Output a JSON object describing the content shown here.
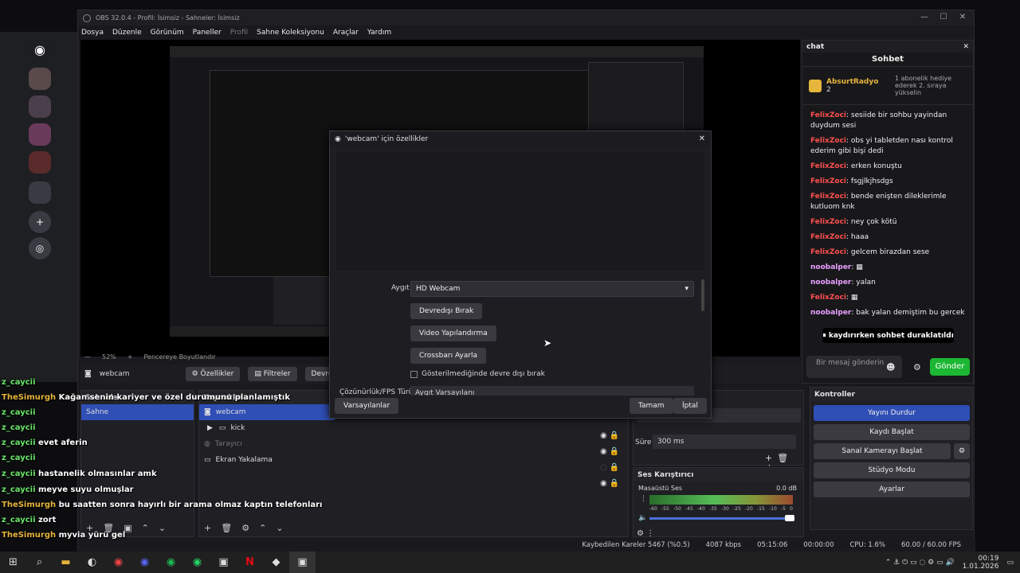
{
  "discord": {
    "icons": [
      "discord-icon",
      "server-1",
      "server-2",
      "server-3",
      "server-4",
      "server-5",
      "add-server",
      "explore"
    ]
  },
  "obs": {
    "window_title": "OBS 32.0.4 - Profil: İsimsiz - Sahneler: İsimsiz",
    "menu": [
      "Dosya",
      "Düzenle",
      "Görünüm",
      "Paneller",
      "Profil",
      "Sahne Koleksiyonu",
      "Araçlar",
      "Yardım"
    ],
    "preview_zoom": "52%",
    "preview_fit": "Pencereye Boyutlandır",
    "source_name": "webcam",
    "source_buttons": {
      "properties": "Özellikler",
      "filters": "Filtreler",
      "deactivate": "Devre"
    },
    "scenes_title": "Sahneler",
    "scenes": [
      "Sahne"
    ],
    "sources_title": "Kaynaklar",
    "sources": [
      "webcam",
      "kick",
      "Tarayıcı",
      "Ekran Yakalama"
    ],
    "transition_duration_label": "Süre",
    "transition_duration": "300 ms",
    "mixer_title": "Ses Karıştırıcı",
    "mixer_channel": "Masaüstü Ses",
    "mixer_db": "0.0 dB",
    "mixer_scale": [
      "-60",
      "-55",
      "-50",
      "-45",
      "-40",
      "-35",
      "-30",
      "-25",
      "-20",
      "-15",
      "-10",
      "-5",
      "0"
    ],
    "controls_title": "Kontroller",
    "controls": [
      "Yayını Durdur",
      "Kaydı Başlat",
      "Sanal Kamerayı Başlat",
      "Stüdyo Modu",
      "Ayarlar"
    ],
    "status": {
      "dropped": "Kaybedilen Kareler 5467 (%0.5)",
      "bitrate": "4087 kbps",
      "stream_time": "05:15:06",
      "rec_time": "00:00:00",
      "cpu": "CPU: 1.6%",
      "fps": "60.00 / 60.00 FPS"
    }
  },
  "dialog": {
    "title": "'webcam' için özellikler",
    "device_label": "Aygıt",
    "device_value": "HD Webcam",
    "btn_deactivate": "Devredışı Bırak",
    "btn_video_config": "Video Yapılandırma",
    "btn_crossbar": "Crossbarı Ayarla",
    "checkbox_label": "Gösterilmediğinde devre dışı bırak",
    "resolution_label": "Çözünürlük/FPS Türü",
    "resolution_value": "Aygıt Varsayılanı",
    "btn_defaults": "Varsayılanlar",
    "btn_ok": "Tamam",
    "btn_cancel": "İptal"
  },
  "chat": {
    "dock_title": "chat",
    "title": "Sohbet",
    "hype_user": "AbsurtRadyo",
    "hype_count": "2",
    "hype_text": "1 abonelik hediye ederek 2. sıraya yükselin",
    "messages": [
      {
        "user": "FelixZoci",
        "text": "sesiide bir sohbu yayindan duydum sesi"
      },
      {
        "user": "FelixZoci",
        "text": "obs yi tabletden nası kontrol ederim gibi bişi dedi"
      },
      {
        "user": "FelixZoci",
        "text": "erken konuştu"
      },
      {
        "user": "FelixZoci",
        "text": "fsgjlkjhsdgs"
      },
      {
        "user": "FelixZoci",
        "text": "bende enişten dileklerimle kutluom knk"
      },
      {
        "user": "FelixZoci",
        "text": "ney çok kötü"
      },
      {
        "user": "FelixZoci",
        "text": "haaa"
      },
      {
        "user": "FelixZoci",
        "text": "gelcem birazdan sese"
      },
      {
        "user": "noobalper",
        "text": ""
      },
      {
        "user": "noobalper",
        "text": "yalan"
      },
      {
        "user": "FelixZoci",
        "text": ""
      },
      {
        "user": "noobalper",
        "text": "bak yalan demiştim bu gercek"
      }
    ],
    "paused": "kaydırırken sohbet duraklatıldı",
    "input_placeholder": "Bir mesaj gönderin",
    "send": "Gönder"
  },
  "overlay": [
    {
      "user": "z_caycii",
      "text": "",
      "color": "green"
    },
    {
      "user": "TheSimurgh",
      "text": "Kağan senin kariyer ve özel durumunu planlamıştık",
      "color": "gold"
    },
    {
      "user": "z_caycii",
      "text": "",
      "color": "green"
    },
    {
      "user": "z_caycii",
      "text": "",
      "color": "green"
    },
    {
      "user": "z_caycii",
      "text": "evet aferin",
      "color": "green"
    },
    {
      "user": "z_caycii",
      "text": "",
      "color": "green"
    },
    {
      "user": "z_caycii",
      "text": "hastanelik olmasınlar amk",
      "color": "green"
    },
    {
      "user": "z_caycii",
      "text": "meyve suyu olmuşlar",
      "color": "green"
    },
    {
      "user": "TheSimurgh",
      "text": "bu saatten sonra hayırlı bir arama olmaz kaptın telefonları",
      "color": "gold"
    },
    {
      "user": "z_caycii",
      "text": "zort",
      "color": "green"
    },
    {
      "user": "TheSimurgh",
      "text": "myvia yürü gel",
      "color": "gold"
    }
  ],
  "taskbar": {
    "time": "00:19",
    "date": "1.01.2026"
  }
}
